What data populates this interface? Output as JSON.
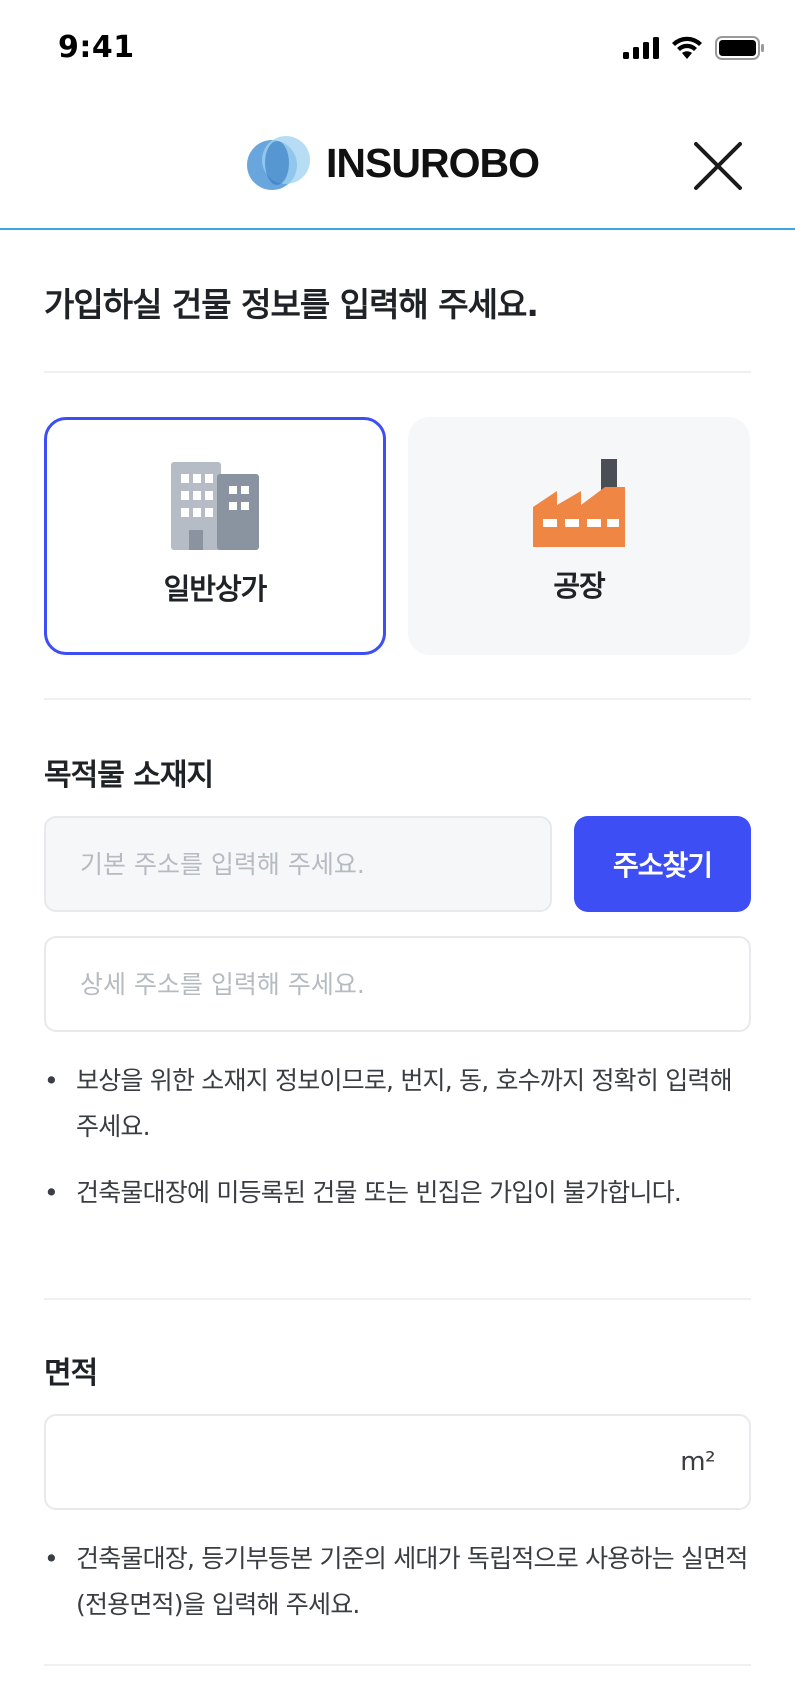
{
  "status_bar": {
    "time": "9:41"
  },
  "header": {
    "brand_name": "INSUROBO"
  },
  "main": {
    "title": "가입하실 건물 정보를 입력해 주세요.",
    "building_types": [
      {
        "label": "일반상가",
        "selected": true
      },
      {
        "label": "공장",
        "selected": false
      }
    ],
    "location": {
      "title": "목적물 소재지",
      "basic_address_placeholder": "기본 주소를 입력해 주세요.",
      "search_button_label": "주소찾기",
      "detail_address_placeholder": "상세 주소를 입력해 주세요.",
      "notes": [
        "보상을 위한 소재지 정보이므로, 번지, 동, 호수까지 정확히 입력해 주세요.",
        "건축물대장에 미등록된 건물 또는 빈집은 가입이 불가합니다."
      ]
    },
    "area": {
      "title": "면적",
      "unit": "m²",
      "notes": [
        "건축물대장, 등기부등본 기준의 세대가 독립적으로 사용하는 실면적(전용면적)을 입력해 주세요."
      ]
    }
  },
  "colors": {
    "accent": "#3d4ef5",
    "header_line": "#3fa3e6",
    "factory": "#ef8644"
  }
}
